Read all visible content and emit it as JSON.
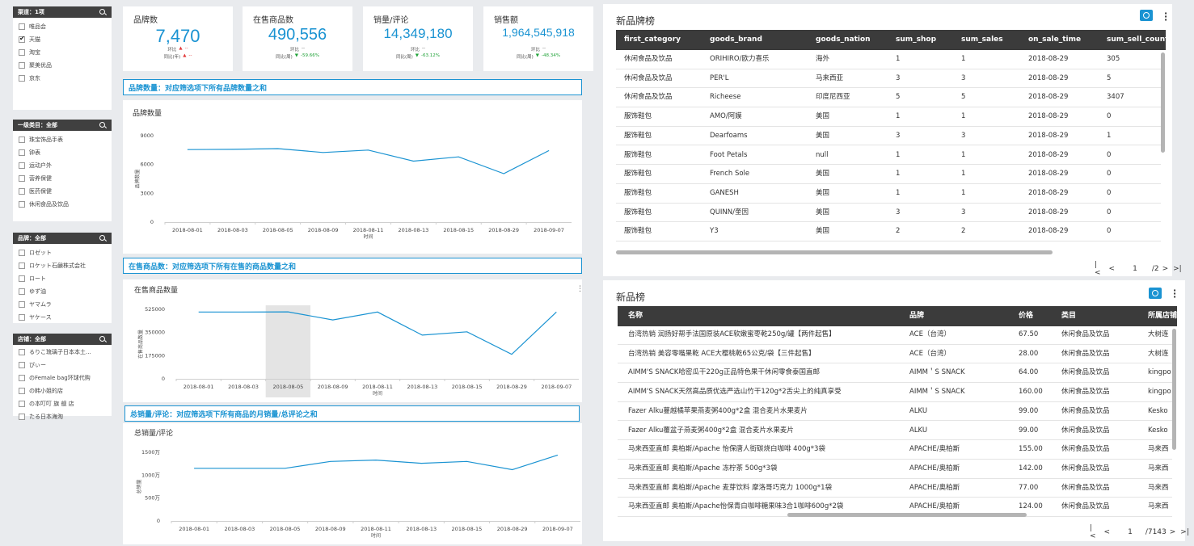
{
  "filters": {
    "channel": {
      "title": "渠道：1项",
      "items": [
        {
          "label": "唯品会",
          "checked": false
        },
        {
          "label": "天猫",
          "checked": true
        },
        {
          "label": "淘宝",
          "checked": false
        },
        {
          "label": "聚美优品",
          "checked": false
        },
        {
          "label": "京东",
          "checked": false
        }
      ]
    },
    "category": {
      "title": "一级类目：全部",
      "items": [
        {
          "label": "珠宝饰品手表",
          "checked": false
        },
        {
          "label": "钟表",
          "checked": false
        },
        {
          "label": "运动户外",
          "checked": false
        },
        {
          "label": "营养保健",
          "checked": false
        },
        {
          "label": "医药保健",
          "checked": false
        },
        {
          "label": "休闲食品及饮品",
          "checked": false
        }
      ]
    },
    "brand": {
      "title": "品牌：全部",
      "items": [
        {
          "label": "ロゼット",
          "checked": false
        },
        {
          "label": "ロケット石鹸株式会社",
          "checked": false
        },
        {
          "label": "ロート",
          "checked": false
        },
        {
          "label": "ゆず油",
          "checked": false
        },
        {
          "label": "ヤマムラ",
          "checked": false
        },
        {
          "label": "ヤケース",
          "checked": false
        }
      ]
    },
    "shop": {
      "title": "店铺：全部",
      "items": [
        {
          "label": "るりこ琉璃子日本本土...",
          "checked": false
        },
        {
          "label": "ぴぃー",
          "checked": false
        },
        {
          "label": "のFemale bag环球代购",
          "checked": false
        },
        {
          "label": "の韩小姐的店",
          "checked": false
        },
        {
          "label": "の本叮叮 旗 舰 店",
          "checked": false
        },
        {
          "label": "たる日本海淘",
          "checked": false
        }
      ]
    }
  },
  "kpis": [
    {
      "label": "品牌数",
      "value": "7,470",
      "sub1_label": "环比",
      "sub1_val": "--",
      "sub1_dir": "up",
      "sub2_label": "同比(年)",
      "sub2_val": "--",
      "sub2_dir": "up"
    },
    {
      "label": "在售商品数",
      "value": "490,556",
      "sub1_label": "环比",
      "sub1_val": "--",
      "sub1_dir": "none",
      "sub2_label": "同比(周)",
      "sub2_val": "-59.66%",
      "sub2_dir": "down"
    },
    {
      "label": "销量/评论",
      "value": "14,349,180",
      "sub1_label": "环比",
      "sub1_val": "--",
      "sub1_dir": "none",
      "sub2_label": "同比(周)",
      "sub2_val": "-63.12%",
      "sub2_dir": "down"
    },
    {
      "label": "销售额",
      "value": "1,964,545,918",
      "sub1_label": "环比",
      "sub1_val": "--",
      "sub1_dir": "none",
      "sub2_label": "同比(周)",
      "sub2_val": "-48.34%",
      "sub2_dir": "down"
    }
  ],
  "sections": {
    "s1": "品牌数量：对应筛选项下所有品牌数量之和",
    "s2": "在售商品数：对应筛选项下所有在售的商品数量之和",
    "s3": "总销量/评论：对应筛选项下所有商品的月销量/总评论之和"
  },
  "chart_data": [
    {
      "type": "line",
      "title": "品牌数量",
      "xlabel": "时间",
      "ylabel": "品牌数量",
      "categories": [
        "2018-08-01",
        "2018-08-03",
        "2018-08-05",
        "2018-08-09",
        "2018-08-11",
        "2018-08-13",
        "2018-08-15",
        "2018-08-29",
        "2018-09-07"
      ],
      "values": [
        7550,
        7580,
        7650,
        7250,
        7500,
        6350,
        6800,
        5050,
        7450
      ],
      "yticks": [
        0,
        3000,
        6000,
        9000
      ],
      "yticklabels": [
        "0",
        "3000",
        "6000",
        "9000"
      ],
      "ylim": [
        0,
        9000
      ],
      "color": "#1a93d2",
      "highlight_index": -1
    },
    {
      "type": "line",
      "title": "在售商品数量",
      "xlabel": "时间",
      "ylabel": "在售商品数量",
      "categories": [
        "2018-08-01",
        "2018-08-03",
        "2018-08-05",
        "2018-08-09",
        "2018-08-11",
        "2018-08-13",
        "2018-08-15",
        "2018-08-29",
        "2018-09-07"
      ],
      "values": [
        505000,
        505000,
        506000,
        445000,
        505000,
        330000,
        355000,
        185000,
        505000
      ],
      "yticks": [
        0,
        175000,
        350000,
        525000
      ],
      "yticklabels": [
        "0",
        "175000",
        "350000",
        "525000"
      ],
      "ylim": [
        0,
        525000
      ],
      "color": "#1a93d2",
      "highlight_index": 2
    },
    {
      "type": "line",
      "title": "总销量/评论",
      "xlabel": "时间",
      "ylabel": "总销量",
      "categories": [
        "2018-08-01",
        "2018-08-03",
        "2018-08-05",
        "2018-08-09",
        "2018-08-11",
        "2018-08-13",
        "2018-08-15",
        "2018-08-29",
        "2018-09-07"
      ],
      "values": [
        11500000,
        11500000,
        11500000,
        13000000,
        13300000,
        12600000,
        13000000,
        11200000,
        14400000
      ],
      "yticks": [
        0,
        5000000,
        10000000,
        15000000
      ],
      "yticklabels": [
        "0",
        "500万",
        "1000万",
        "1500万"
      ],
      "ylim": [
        0,
        15000000
      ],
      "color": "#1a93d2",
      "highlight_index": -1
    }
  ],
  "brand_table": {
    "title": "新品牌榜",
    "columns": [
      "first_category",
      "goods_brand",
      "goods_nation",
      "sum_shop",
      "sum_sales",
      "on_sale_time",
      "sum_sell_count"
    ],
    "rows": [
      [
        "休闲食品及饮品",
        "ORIHIRO/欧力喜乐",
        "海外",
        "1",
        "1",
        "2018-08-29",
        "305"
      ],
      [
        "休闲食品及饮品",
        "PER'L",
        "马来西亚",
        "3",
        "3",
        "2018-08-29",
        "5"
      ],
      [
        "休闲食品及饮品",
        "Richeese",
        "印度尼西亚",
        "5",
        "5",
        "2018-08-29",
        "3407"
      ],
      [
        "服饰鞋包",
        "AMO/阿嫫",
        "美国",
        "1",
        "1",
        "2018-08-29",
        "0"
      ],
      [
        "服饰鞋包",
        "Dearfoams",
        "美国",
        "3",
        "3",
        "2018-08-29",
        "1"
      ],
      [
        "服饰鞋包",
        "Foot Petals",
        "null",
        "1",
        "1",
        "2018-08-29",
        "0"
      ],
      [
        "服饰鞋包",
        "French Sole",
        "美国",
        "1",
        "1",
        "2018-08-29",
        "0"
      ],
      [
        "服饰鞋包",
        "GANESH",
        "美国",
        "1",
        "1",
        "2018-08-29",
        "0"
      ],
      [
        "服饰鞋包",
        "QUINN/奎因",
        "美国",
        "3",
        "3",
        "2018-08-29",
        "0"
      ],
      [
        "服饰鞋包",
        "Y3",
        "美国",
        "2",
        "2",
        "2018-08-29",
        "0"
      ]
    ],
    "pager": {
      "current": "1",
      "total": "/2"
    }
  },
  "product_table": {
    "title": "新品榜",
    "columns": [
      "名称",
      "品牌",
      "价格",
      "类目",
      "所属店铺"
    ],
    "rows": [
      [
        "台湾热销 润扬好帮手法国原装ACE软嫩蜜枣乾250g/罐【两件起售】",
        "ACE（台湾）",
        "67.50",
        "休闲食品及饮品",
        "大树连"
      ],
      [
        "台湾热销 美容零嘴果乾 ACE大樱桃乾65公克/袋【三件起售】",
        "ACE（台湾）",
        "28.00",
        "休闲食品及饮品",
        "大树连"
      ],
      [
        "AIMM'S SNACK哈密瓜干220g正品特色果干休闲零食泰国直邮",
        "AIMM＇S SNACK",
        "64.00",
        "休闲食品及饮品",
        "kingpo"
      ],
      [
        "AIMM'S SNACK天然高品质优选严选山竹干120g*2舌尖上的纯真享受",
        "AIMM＇S SNACK",
        "160.00",
        "休闲食品及饮品",
        "kingpo"
      ],
      [
        "Fazer Alku蔓越橘苹果燕麦粥400g*2盒 混合麦片水果麦片",
        "ALKU",
        "99.00",
        "休闲食品及饮品",
        "Kesko"
      ],
      [
        "Fazer Alku覆盆子燕麦粥400g*2盒 混合麦片水果麦片",
        "ALKU",
        "99.00",
        "休闲食品及饮品",
        "Kesko"
      ],
      [
        "马来西亚直邮 奥柏斯/Apache 怡保唐人街碳烧白咖啡 400g*3袋",
        "APACHE/奥柏斯",
        "155.00",
        "休闲食品及饮品",
        "马来西"
      ],
      [
        "马来西亚直邮 奥柏斯/Apache 冻柠茶 500g*3袋",
        "APACHE/奥柏斯",
        "142.00",
        "休闲食品及饮品",
        "马来西"
      ],
      [
        "马来西亚直邮 奥柏斯/Apache 麦芽饮料 摩洛哥巧克力 1000g*1袋",
        "APACHE/奥柏斯",
        "77.00",
        "休闲食品及饮品",
        "马来西"
      ],
      [
        "马来西亚直邮 奥柏斯/Apache怡保青白咖啡糖果味3合1咖啡600g*2袋",
        "APACHE/奥柏斯",
        "124.00",
        "休闲食品及饮品",
        "马来西"
      ]
    ],
    "pager": {
      "current": "1",
      "total": "/7143"
    }
  }
}
